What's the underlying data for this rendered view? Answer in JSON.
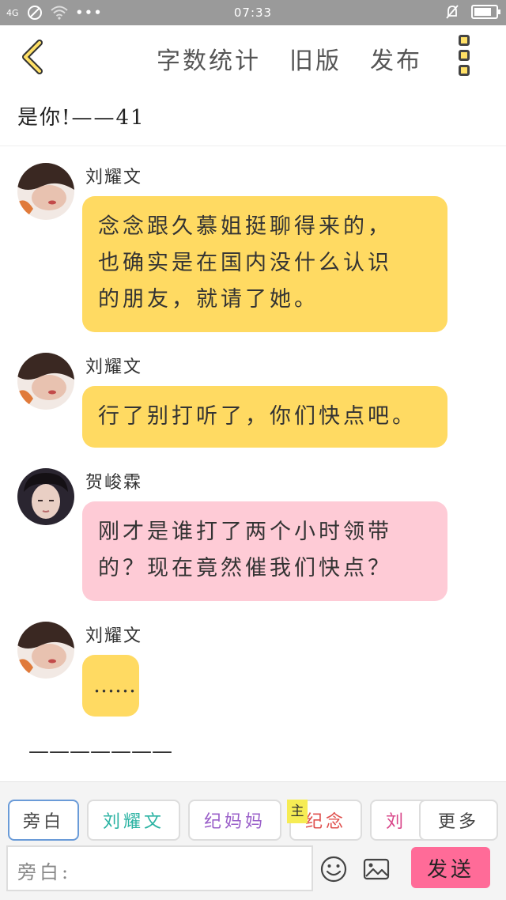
{
  "status_bar": {
    "signal": "4G",
    "time": "07:33"
  },
  "header": {
    "nav": [
      "字数统计",
      "旧版",
      "发布"
    ]
  },
  "chapter_title": "是你!——41",
  "messages": [
    {
      "sender": "刘耀文",
      "text_lines": [
        "念念跟久慕姐挺聊得来的，",
        "也确实是在国内没什么认识",
        "的朋友，就请了她。"
      ],
      "color": "#ffda62"
    },
    {
      "sender": "刘耀文",
      "text_lines": [
        "行了别打听了，你们快点吧。"
      ],
      "color": "#ffda62"
    },
    {
      "sender": "贺峻霖",
      "text_lines": [
        "刚才是谁打了两个小时领带",
        "的？现在竟然催我们快点？"
      ],
      "color": "#fecbd6"
    },
    {
      "sender": "刘耀文",
      "text_lines": [
        "……"
      ],
      "color": "#ffda62"
    }
  ],
  "scene_break": "———————",
  "roles": [
    {
      "label": "旁白",
      "color": "#555555"
    },
    {
      "label": "刘耀文",
      "color": "#2bb3a3"
    },
    {
      "label": "纪妈妈",
      "color": "#9a5fc9"
    },
    {
      "label": "纪念",
      "color": "#e0524f"
    },
    {
      "label": "刘",
      "color": "#d9478a"
    }
  ],
  "main_badge": "主",
  "more_label": "更多",
  "input": {
    "placeholder": "旁白:"
  },
  "send_label": "发送",
  "icons": [
    "back-arrow-icon",
    "menu-dots-icon",
    "emoji-icon",
    "image-icon"
  ]
}
